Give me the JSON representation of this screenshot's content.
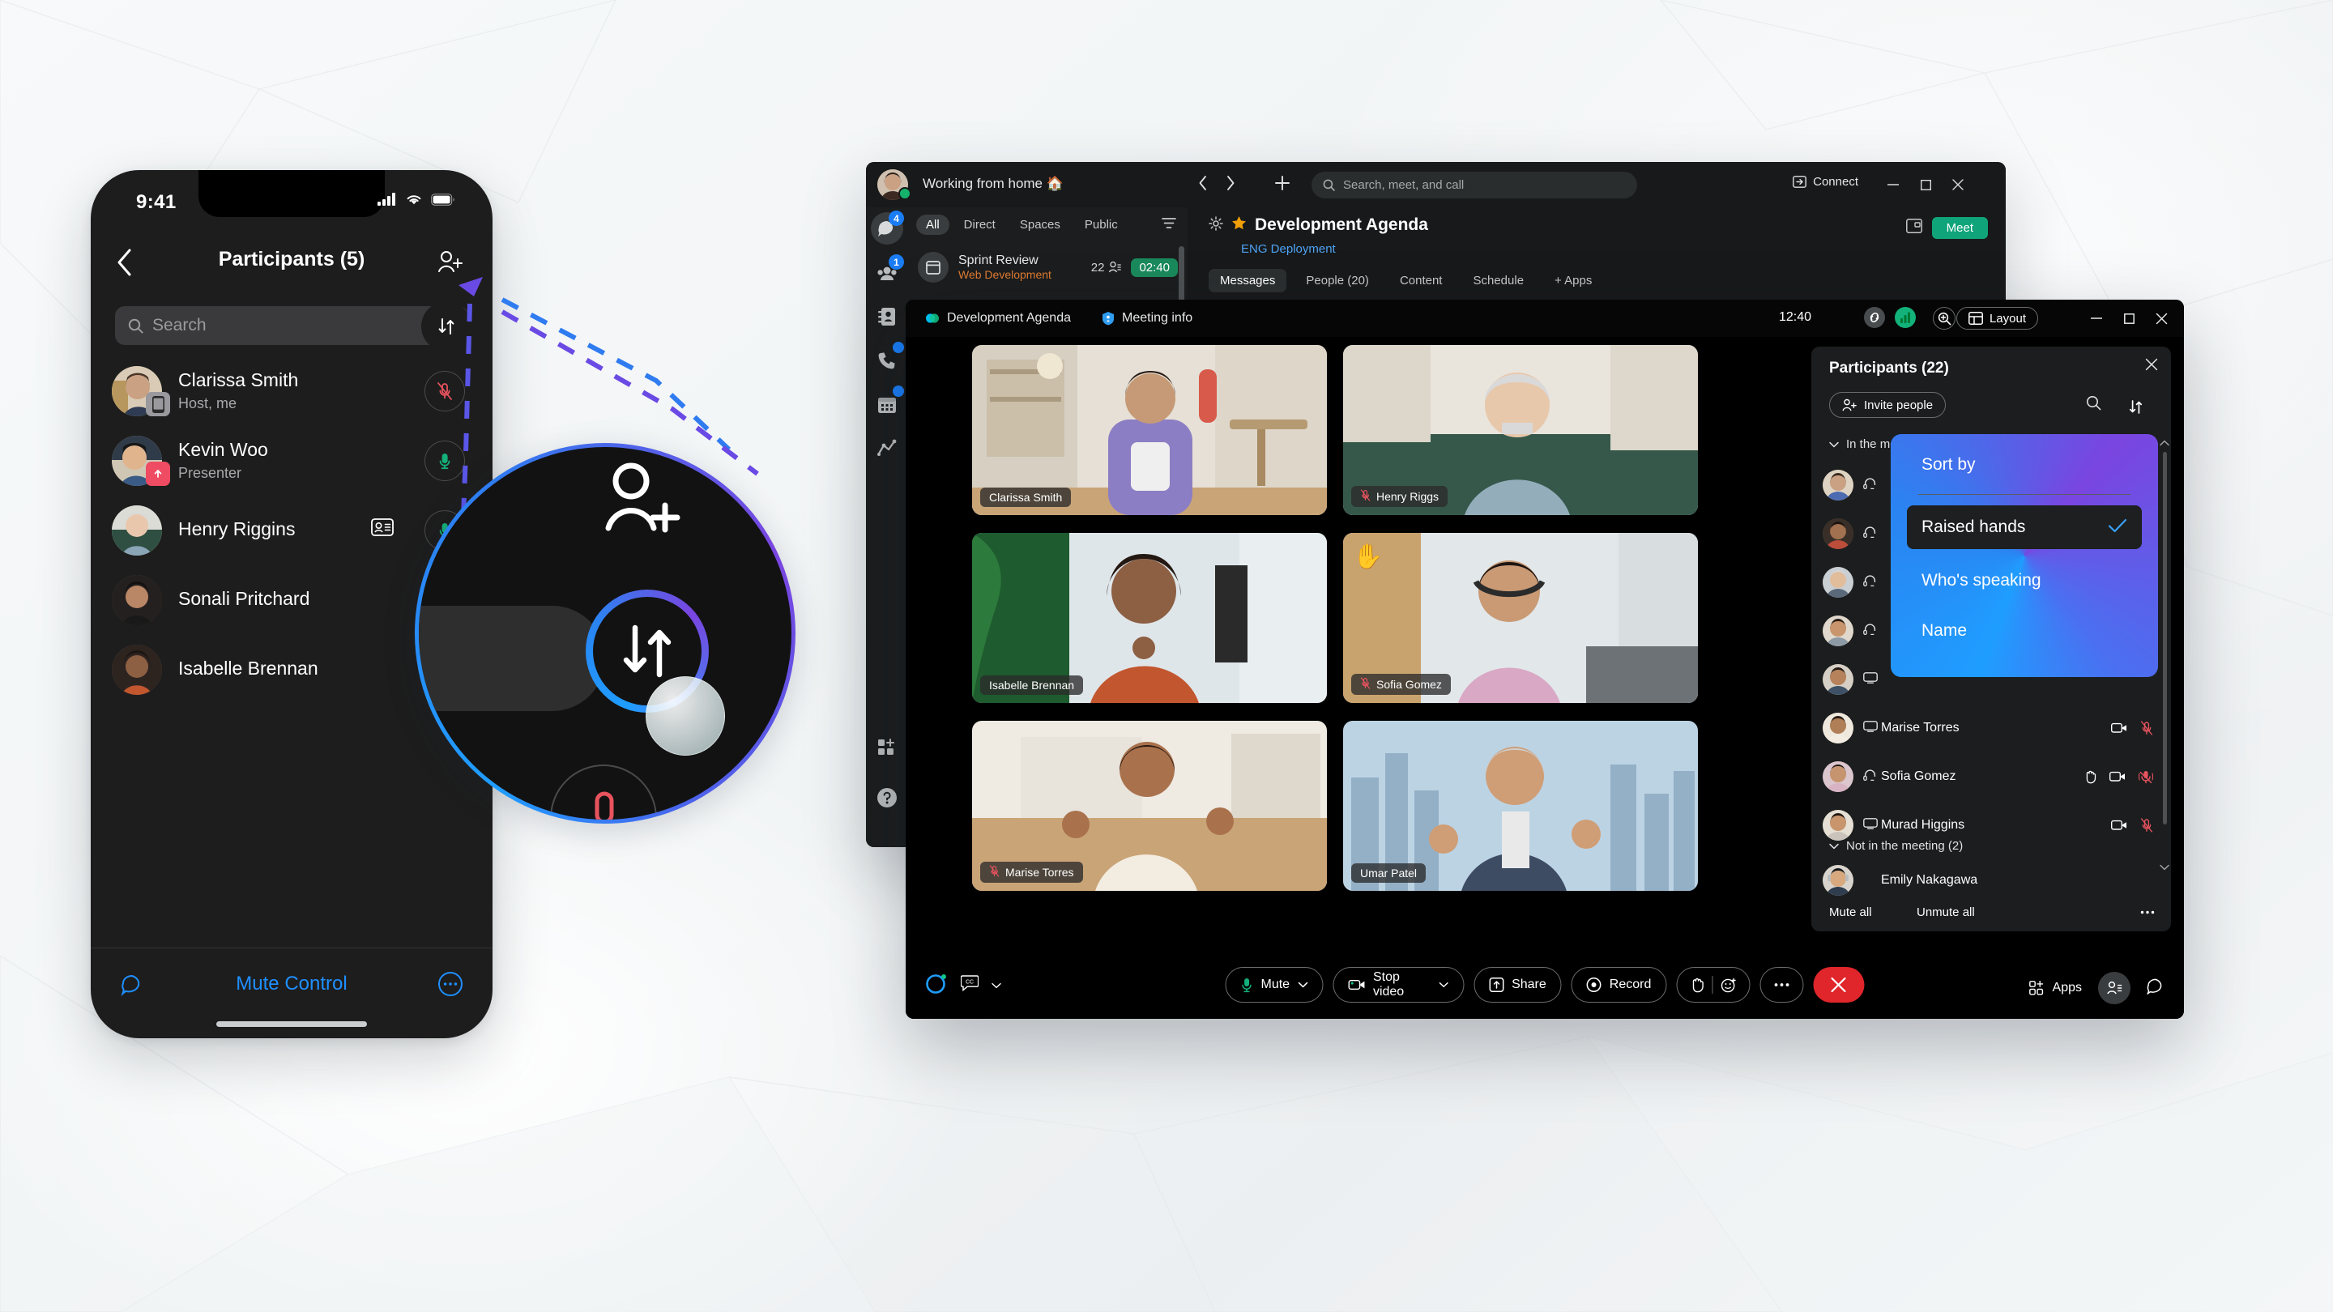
{
  "phone": {
    "status_time": "9:41",
    "status_icons": [
      "signal-icon",
      "wifi-icon",
      "battery-icon"
    ],
    "back_label": "back-chevron",
    "title": "Participants (5)",
    "add_person_label": "add-person-icon",
    "search_placeholder": "Search",
    "sort_button_label": "sort-arrows-icon",
    "participants": [
      {
        "name": "Clarissa Smith",
        "sub": "Host, me",
        "badge": "device-phone",
        "mic": "muted"
      },
      {
        "name": "Kevin Woo",
        "sub": "Presenter",
        "badge": "share-up",
        "mic": "unmuted"
      },
      {
        "name": "Henry Riggins",
        "sub": "",
        "badge": "",
        "mic": "unmuted",
        "info": "contact-card-icon"
      },
      {
        "name": "Sonali Pritchard",
        "sub": "",
        "badge": "",
        "mic": "none"
      },
      {
        "name": "Isabelle Brennan",
        "sub": "",
        "badge": "",
        "mic": "none"
      }
    ],
    "footer": {
      "chat_icon": "chat-bubble-icon",
      "mute_control": "Mute Control",
      "more_icon": "more-circle-icon"
    }
  },
  "magnifier": {
    "add_person_icon": "add-person-icon",
    "sort_icon": "sort-arrows-icon",
    "touch_indicator": "finger-tap-indicator"
  },
  "app": {
    "presence_status": "Working from home 🏠",
    "nav_back": "back-chevron",
    "nav_forward": "forward-chevron",
    "new_icon": "plus-icon",
    "search_placeholder": "Search, meet, and call",
    "connect_label": "Connect",
    "window_controls": {
      "minimize": "minimize-icon",
      "maximize": "maximize-icon",
      "close": "close-icon"
    },
    "rail": [
      {
        "name": "messaging",
        "badge": "4",
        "active": true
      },
      {
        "name": "teams",
        "badge": "1",
        "active": false
      },
      {
        "name": "contacts",
        "badge": "",
        "active": false
      },
      {
        "name": "calling",
        "badge": "",
        "active": false
      },
      {
        "name": "meetings",
        "badge": "",
        "active": false
      },
      {
        "name": "insights",
        "badge": "",
        "active": false
      },
      {
        "name": "apps",
        "badge": "",
        "active": false
      },
      {
        "name": "help",
        "badge": "",
        "active": false
      }
    ],
    "filters": [
      "All",
      "Direct",
      "Spaces",
      "Public"
    ],
    "active_filter": "All",
    "filter_sort_icon": "filter-icon",
    "list_item": {
      "icon": "calendar-icon",
      "title": "Sprint Review",
      "subtitle": "Web Development",
      "participant_count": "22",
      "participants_icon": "people-icon",
      "timer": "02:40"
    },
    "space": {
      "settings_icon": "gear-icon",
      "favorite_icon": "star-icon",
      "title": "Development Agenda",
      "subtitle": "ENG Deployment",
      "meet_label": "Meet",
      "window_icon": "open-window-icon",
      "tabs": [
        "Messages",
        "People (20)",
        "Content",
        "Schedule",
        "+ Apps"
      ]
    }
  },
  "meeting": {
    "tabs": [
      {
        "label": "Development Agenda",
        "icon": "webex-icon"
      },
      {
        "label": "Meeting info",
        "icon": "info-shield-icon"
      }
    ],
    "clock": "12:40",
    "header_icons": [
      "link-icon",
      "network-quality-icon"
    ],
    "zoom_icon": "zoom-in-icon",
    "layout_label": "Layout",
    "layout_icon": "grid-icon",
    "window_controls": {
      "minimize": "minimize-icon",
      "maximize": "maximize-icon",
      "close": "close-icon"
    },
    "tiles": [
      {
        "name": "Clarissa Smith",
        "muted": false,
        "hand_raised": false
      },
      {
        "name": "Henry Riggs",
        "muted": true,
        "hand_raised": false
      },
      {
        "name": "Isabelle Brennan",
        "muted": false,
        "hand_raised": false
      },
      {
        "name": "Sofia Gomez",
        "muted": true,
        "hand_raised": true
      },
      {
        "name": "Marise Torres",
        "muted": true,
        "hand_raised": false
      },
      {
        "name": "Umar Patel",
        "muted": false,
        "hand_raised": false
      }
    ],
    "dock": {
      "top_icon": "scroll-top-icon",
      "up_icon": "chevron-up-icon",
      "down_icon": "chevron-down-icon"
    },
    "toolbar": {
      "webex_icon": "webex-logo-icon",
      "cc_icon": "closed-caption-icon",
      "cc_chevron": "chevron-down-icon",
      "mute_label": "Mute",
      "mute_icon": "microphone-icon",
      "video_label": "Stop video",
      "video_icon": "camera-icon",
      "share_label": "Share",
      "share_icon": "share-up-icon",
      "record_label": "Record",
      "record_icon": "record-icon",
      "hand_icon": "raise-hand-icon",
      "reaction_icon": "reaction-smiley-icon",
      "more_icon": "more-ellipsis-icon",
      "end_icon": "end-call-icon",
      "apps_label": "Apps",
      "apps_icon": "apps-grid-icon",
      "people_icon": "people-panel-icon",
      "chat_icon": "chat-bubble-icon"
    }
  },
  "panel": {
    "title": "Participants (22)",
    "close_icon": "close-icon",
    "invite_label": "Invite people",
    "invite_icon": "add-person-icon",
    "search_icon": "search-icon",
    "sort_icon": "sort-arrows-icon",
    "section_in": "In the meeting (20)",
    "section_out": "Not in the meeting (2)",
    "in_meeting_visible": [
      {
        "name": "Marise Torres",
        "device": "device-board-icon",
        "hand": false,
        "video": true,
        "mic": "muted"
      },
      {
        "name": "Sofia Gomez",
        "device": "headset-icon",
        "hand": true,
        "video": true,
        "mic": "muted-speaking"
      },
      {
        "name": "Murad Higgins",
        "device": "device-board-icon",
        "hand": false,
        "video": true,
        "mic": "muted"
      }
    ],
    "hidden_rows": [
      {
        "device": "headset-icon"
      },
      {
        "device": "headset-icon"
      },
      {
        "device": "headset-icon"
      },
      {
        "device": "headset-icon"
      },
      {
        "device": "device-board-icon"
      }
    ],
    "not_in_meeting": [
      {
        "name": "Emily Nakagawa"
      }
    ],
    "footer": {
      "mute_all": "Mute all",
      "unmute_all": "Unmute all",
      "more_icon": "more-ellipsis-icon"
    }
  },
  "sort_menu": {
    "title": "Sort by",
    "items": [
      {
        "label": "Raised hands",
        "selected": true
      },
      {
        "label": "Who's speaking",
        "selected": false
      },
      {
        "label": "Name",
        "selected": false
      }
    ],
    "check_icon": "checkmark-icon"
  },
  "colors": {
    "accent_blue": "#1f9dff",
    "accent_purple": "#7a45e0",
    "green": "#10a47a",
    "red": "#e0252b",
    "mic_red": "#e8535e",
    "orange": "#e07c32"
  }
}
